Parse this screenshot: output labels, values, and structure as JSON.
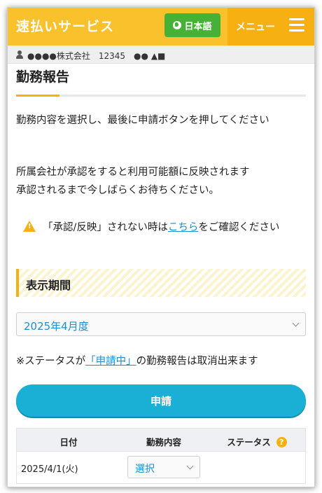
{
  "header": {
    "brand": "速払いサービス",
    "language_button": "日本語",
    "menu_label": "メニュー"
  },
  "subbar": {
    "company": "●●●●株式会社　12345　●● ▲■"
  },
  "page": {
    "title": "勤務報告",
    "instruction_1": "勤務内容を選択し、最後に申請ボタンを押してください",
    "instruction_2_line1": "所属会社が承認をすると利用可能額に反映されます",
    "instruction_2_line2": "承認されるまで今しばらくお待ちください。",
    "warning_prefix": "「承認/反映」されない時は",
    "warning_link": "こちら",
    "warning_suffix": "をご確認ください"
  },
  "period": {
    "label": "表示期間",
    "selected": "2025年4月度"
  },
  "note": {
    "prefix": "※ステータスが",
    "status_link": "「申請中」",
    "suffix": "の勤務報告は取消出来ます"
  },
  "submit_label": "申請",
  "table": {
    "headers": [
      "日付",
      "勤務内容",
      "ステータス"
    ],
    "rows": [
      {
        "date": "2025/4/1(火)",
        "work": "選択",
        "status": ""
      }
    ]
  },
  "colors": {
    "header_yellow": "#f9c12b",
    "menu_orange": "#f6b012",
    "lang_green": "#46b235",
    "primary_blue": "#1ab0d5",
    "link_blue": "#1a8fd1"
  }
}
